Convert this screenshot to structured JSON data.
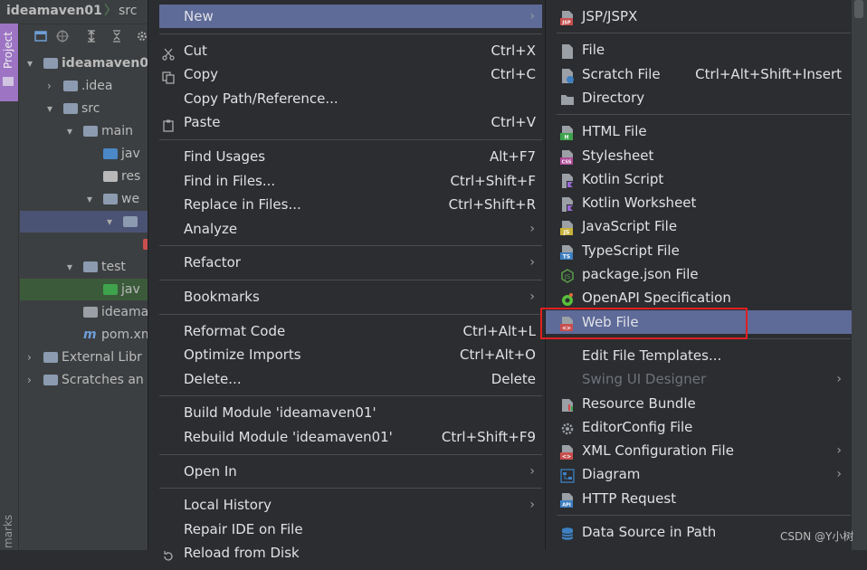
{
  "ide": {
    "project_name": "ideamaven01",
    "breadcrumb_sep": "〉",
    "breadcrumb_item": "src",
    "project_tab": "Project",
    "bookmarks_tab": "marks",
    "tree": [
      {
        "label": "ideamaven0",
        "arrow": "▾",
        "depth": 0,
        "icon": "module-folder",
        "bold": true
      },
      {
        "label": ".idea",
        "arrow": "›",
        "depth": 1,
        "icon": "folder"
      },
      {
        "label": "src",
        "arrow": "▾",
        "depth": 1,
        "icon": "folder"
      },
      {
        "label": "main",
        "arrow": "▾",
        "depth": 2,
        "icon": "folder"
      },
      {
        "label": "jav",
        "arrow": "",
        "depth": 3,
        "icon": "source-folder"
      },
      {
        "label": "res",
        "arrow": "",
        "depth": 3,
        "icon": "resource-folder"
      },
      {
        "label": "we",
        "arrow": "▾",
        "depth": 3,
        "icon": "web-folder"
      },
      {
        "label": "",
        "arrow": "▾",
        "depth": 4,
        "icon": "folder",
        "selected": true
      },
      {
        "label": "",
        "arrow": "",
        "depth": 5,
        "icon": "jsp-file"
      },
      {
        "label": "test",
        "arrow": "▾",
        "depth": 2,
        "icon": "folder"
      },
      {
        "label": "jav",
        "arrow": "",
        "depth": 3,
        "icon": "test-folder",
        "test": true
      },
      {
        "label": "ideamave",
        "arrow": "",
        "depth": 2,
        "icon": "iml-file"
      },
      {
        "label": "pom.xml",
        "arrow": "",
        "depth": 2,
        "icon": "maven-icon"
      },
      {
        "label": "External Libr",
        "arrow": "›",
        "depth": 0,
        "icon": "library-icon"
      },
      {
        "label": "Scratches an",
        "arrow": "›",
        "depth": 0,
        "icon": "scratches-icon"
      }
    ]
  },
  "menu": {
    "items": [
      {
        "label": "New",
        "shortcut": "",
        "submenu": true,
        "icon": "",
        "highlighted": true
      },
      {
        "sep": true
      },
      {
        "label": "Cut",
        "shortcut": "Ctrl+X",
        "icon": "scissors-icon"
      },
      {
        "label": "Copy",
        "shortcut": "Ctrl+C",
        "icon": "copy-icon"
      },
      {
        "label": "Copy Path/Reference...",
        "shortcut": "",
        "icon": ""
      },
      {
        "label": "Paste",
        "shortcut": "Ctrl+V",
        "icon": "paste-icon"
      },
      {
        "sep": true
      },
      {
        "label": "Find Usages",
        "shortcut": "Alt+F7",
        "icon": ""
      },
      {
        "label": "Find in Files...",
        "shortcut": "Ctrl+Shift+F",
        "icon": ""
      },
      {
        "label": "Replace in Files...",
        "shortcut": "Ctrl+Shift+R",
        "icon": ""
      },
      {
        "label": "Analyze",
        "shortcut": "",
        "submenu": true,
        "icon": ""
      },
      {
        "sep": true
      },
      {
        "label": "Refactor",
        "shortcut": "",
        "submenu": true,
        "icon": ""
      },
      {
        "sep": true
      },
      {
        "label": "Bookmarks",
        "shortcut": "",
        "submenu": true,
        "icon": ""
      },
      {
        "sep": true
      },
      {
        "label": "Reformat Code",
        "shortcut": "Ctrl+Alt+L",
        "icon": ""
      },
      {
        "label": "Optimize Imports",
        "shortcut": "Ctrl+Alt+O",
        "icon": ""
      },
      {
        "label": "Delete...",
        "shortcut": "Delete",
        "icon": ""
      },
      {
        "sep": true
      },
      {
        "label": "Build Module 'ideamaven01'",
        "shortcut": "",
        "icon": ""
      },
      {
        "label": "Rebuild Module 'ideamaven01'",
        "shortcut": "Ctrl+Shift+F9",
        "icon": ""
      },
      {
        "sep": true
      },
      {
        "label": "Open In",
        "shortcut": "",
        "submenu": true,
        "icon": ""
      },
      {
        "sep": true
      },
      {
        "label": "Local History",
        "shortcut": "",
        "submenu": true,
        "icon": ""
      },
      {
        "label": "Repair IDE on File",
        "shortcut": "",
        "icon": ""
      },
      {
        "label": "Reload from Disk",
        "shortcut": "",
        "icon": "reload-icon"
      }
    ]
  },
  "submenu": {
    "items": [
      {
        "label": "JSP/JSPX",
        "icon": "jsp-icon",
        "color": "#c94f4f",
        "tag": "JSP"
      },
      {
        "sep": true
      },
      {
        "label": "File",
        "icon": "file-icon",
        "color": "#9aa0a6"
      },
      {
        "label": "Scratch File",
        "shortcut": "Ctrl+Alt+Shift+Insert",
        "icon": "scratch-file-icon",
        "color": "#9aa0a6"
      },
      {
        "label": "Directory",
        "icon": "directory-icon",
        "color": "#9aa0a6"
      },
      {
        "sep": true
      },
      {
        "label": "HTML File",
        "icon": "html-icon",
        "color": "#3fa34d",
        "tag": "H"
      },
      {
        "label": "Stylesheet",
        "icon": "css-icon",
        "color": "#b04c9a",
        "tag": "CSS"
      },
      {
        "label": "Kotlin Script",
        "icon": "kotlin-script-icon",
        "color": "#9a6ad6"
      },
      {
        "label": "Kotlin Worksheet",
        "icon": "kotlin-worksheet-icon",
        "color": "#9a6ad6"
      },
      {
        "label": "JavaScript File",
        "icon": "javascript-icon",
        "color": "#c9b23a",
        "tag": "JS"
      },
      {
        "label": "TypeScript File",
        "icon": "typescript-icon",
        "color": "#3d7fc1",
        "tag": "TS"
      },
      {
        "label": "package.json File",
        "icon": "nodejs-icon",
        "color": "#5b9d4a"
      },
      {
        "label": "OpenAPI Specification",
        "icon": "openapi-icon",
        "color": "#5bbf3a"
      },
      {
        "label": "Web File",
        "icon": "web-file-icon",
        "color": "#c94f4f",
        "highlighted": true,
        "tag": "<>"
      },
      {
        "sep": true
      },
      {
        "label": "Edit File Templates...",
        "icon": ""
      },
      {
        "label": "Swing UI Designer",
        "icon": "",
        "disabled": true,
        "submenu": true
      },
      {
        "label": "Resource Bundle",
        "icon": "resource-bundle-icon",
        "color": "#9aa0a6"
      },
      {
        "label": "EditorConfig File",
        "icon": "gear-icon",
        "color": "#9aa0a6"
      },
      {
        "label": "XML Configuration File",
        "icon": "xml-icon",
        "color": "#c94f4f",
        "submenu": true,
        "tag": "<>"
      },
      {
        "label": "Diagram",
        "icon": "diagram-icon",
        "color": "#3d7fc1",
        "submenu": true
      },
      {
        "label": "HTTP Request",
        "icon": "api-icon",
        "color": "#3d7fc1",
        "tag": "API"
      },
      {
        "sep": true
      },
      {
        "label": "Data Source in Path",
        "icon": "database-icon",
        "color": "#3d7fc1"
      }
    ]
  },
  "watermark": "CSDN @Y小树",
  "colors": {
    "menu_bg": "#2b2d30",
    "highlight": "#5e6a98",
    "annotation_box": "#e02020"
  }
}
